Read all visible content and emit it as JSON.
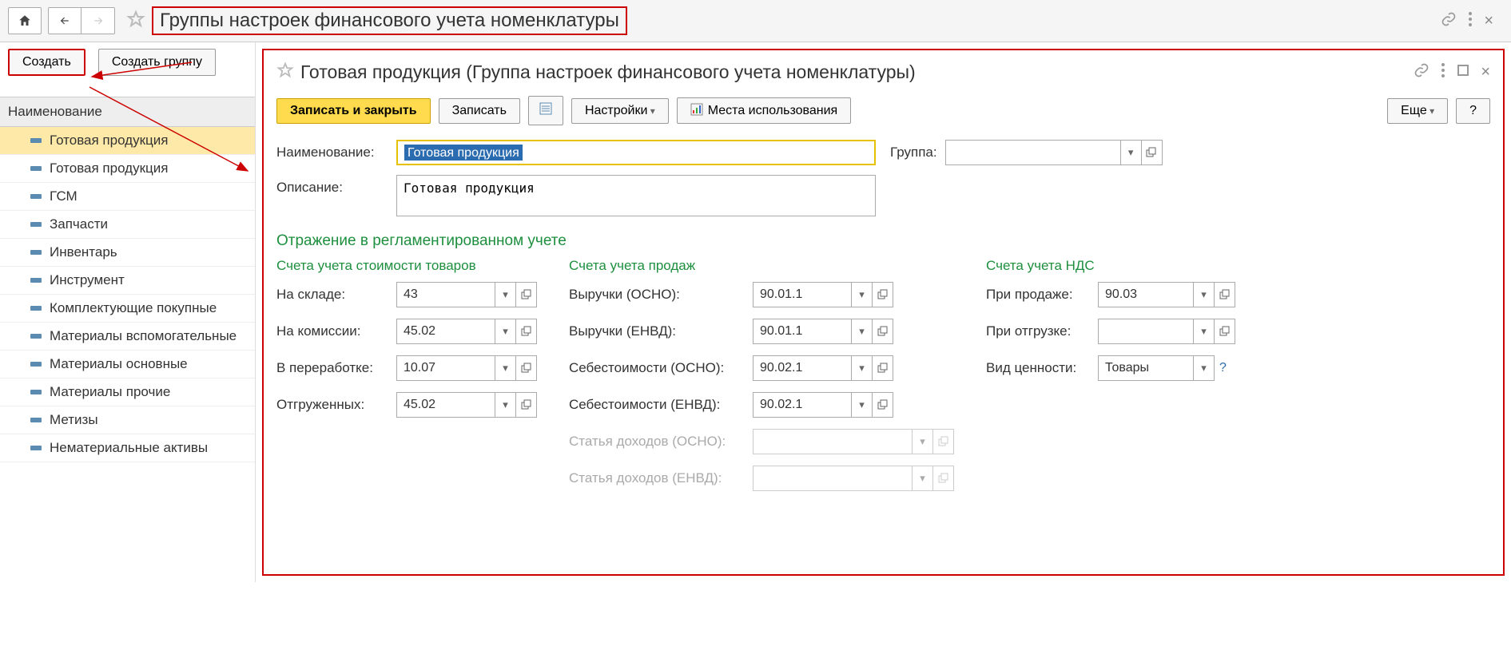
{
  "pageTitle": "Группы настроек финансового учета номенклатуры",
  "toolbar": {
    "create": "Создать",
    "createGroup": "Создать группу"
  },
  "listHeader": "Наименование",
  "listItems": [
    "Готовая продукция",
    "Готовая продукция",
    "ГСМ",
    "Запчасти",
    "Инвентарь",
    "Инструмент",
    "Комплектующие покупные",
    "Материалы вспомогательные",
    "Материалы основные",
    "Материалы прочие",
    "Метизы",
    "Нематериальные активы"
  ],
  "form": {
    "title": "Готовая продукция (Группа настроек финансового учета номенклатуры)",
    "btns": {
      "saveClose": "Записать и закрыть",
      "save": "Записать",
      "settings": "Настройки",
      "usages": "Места использования",
      "more": "Еще",
      "help": "?"
    },
    "labels": {
      "name": "Наименование:",
      "desc": "Описание:",
      "group": "Группа:"
    },
    "nameValue": "Готовая продукция",
    "descValue": "Готовая продукция",
    "sectionTitle": "Отражение в регламентированном учете",
    "sub1": "Счета учета стоимости товаров",
    "sub2": "Счета учета продаж",
    "sub3": "Счета учета НДС",
    "col1": {
      "r1l": "На складе:",
      "r1v": "43",
      "r2l": "На комиссии:",
      "r2v": "45.02",
      "r3l": "В переработке:",
      "r3v": "10.07",
      "r4l": "Отгруженных:",
      "r4v": "45.02"
    },
    "col2": {
      "r1l": "Выручки (ОСНО):",
      "r1v": "90.01.1",
      "r2l": "Выручки (ЕНВД):",
      "r2v": "90.01.1",
      "r3l": "Себестоимости (ОСНО):",
      "r3v": "90.02.1",
      "r4l": "Себестоимости (ЕНВД):",
      "r4v": "90.02.1",
      "r5l": "Статья доходов (ОСНО):",
      "r6l": "Статья доходов (ЕНВД):"
    },
    "col3": {
      "r1l": "При продаже:",
      "r1v": "90.03",
      "r2l": "При отгрузке:",
      "r2v": "",
      "r3l": "Вид ценности:",
      "r3v": "Товары"
    }
  }
}
